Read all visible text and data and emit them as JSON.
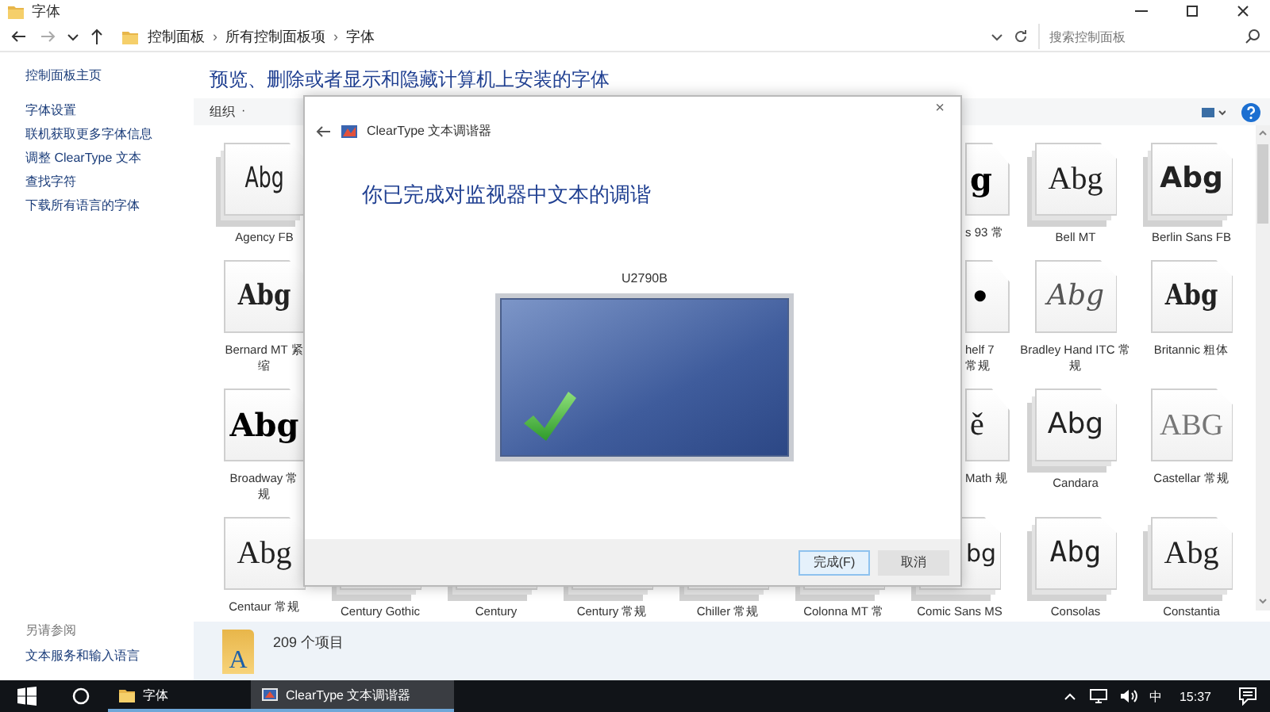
{
  "window": {
    "title": "字体"
  },
  "address_bar": {
    "breadcrumbs": [
      "控制面板",
      "所有控制面板项",
      "字体"
    ],
    "separator": "›"
  },
  "search": {
    "placeholder": "搜索控制面板"
  },
  "sidebar": {
    "home": "控制面板主页",
    "links": [
      "字体设置",
      "联机获取更多字体信息",
      "调整 ClearType 文本",
      "查找字符",
      "下载所有语言的字体"
    ],
    "see_also_title": "另请参阅",
    "see_also": [
      "文本服务和输入语言"
    ]
  },
  "heading": "预览、删除或者显示和隐藏计算机上安装的字体",
  "toolbar": {
    "organize": "组织",
    "organize_caret": "·"
  },
  "font_rows": [
    {
      "tiles": [
        {
          "kind": "full",
          "label": "Agency FB",
          "sample": {
            "text": "Abg",
            "kind": "condensed"
          },
          "stacked": true
        },
        {
          "kind": "cut",
          "label": "s 93 常",
          "sample": {
            "text": "g",
            "kind": "black"
          }
        },
        {
          "kind": "full",
          "label": "Bell MT",
          "sample": {
            "text": "Abg",
            "kind": "serif"
          },
          "stacked": true
        },
        {
          "kind": "full",
          "label": "Berlin Sans FB",
          "sample": {
            "text": "Abg",
            "kind": "bold-sans"
          },
          "stacked": true
        }
      ]
    },
    {
      "tiles": [
        {
          "kind": "full",
          "label": "Bernard MT 紧缩",
          "sample": {
            "text": "Abg",
            "kind": "heavy-serif"
          },
          "stacked": false
        },
        {
          "kind": "cut",
          "label": "helf 7 常规",
          "sample": {
            "text": "•",
            "kind": "black"
          }
        },
        {
          "kind": "full",
          "label": "Bradley Hand ITC 常规",
          "sample": {
            "text": "Abg",
            "kind": "script"
          },
          "stacked": false
        },
        {
          "kind": "full",
          "label": "Britannic 粗体",
          "sample": {
            "text": "Abg",
            "kind": "heavy-serif"
          },
          "stacked": false
        }
      ]
    },
    {
      "tiles": [
        {
          "kind": "full",
          "label": "Broadway 常规",
          "sample": {
            "text": "Abg",
            "kind": "black"
          },
          "stacked": false
        },
        {
          "kind": "cut",
          "label": "Math 规",
          "sample": {
            "text": "ě",
            "kind": "serif"
          }
        },
        {
          "kind": "full",
          "label": "Candara",
          "sample": {
            "text": "Abg",
            "kind": "sans"
          },
          "stacked": true
        },
        {
          "kind": "full",
          "label": "Castellar 常规",
          "sample": {
            "text": "ABG",
            "kind": "caps-serif"
          },
          "stacked": false
        }
      ]
    },
    {
      "tiles": [
        {
          "kind": "full",
          "label": "Centaur 常规",
          "sample": {
            "text": "Abg",
            "kind": "serif"
          },
          "stacked": false
        },
        {
          "kind": "full",
          "label": "Century Gothic",
          "stacked": true
        },
        {
          "kind": "full",
          "label": "Century",
          "stacked": true
        },
        {
          "kind": "full",
          "label": "Century 常规",
          "stacked": true
        },
        {
          "kind": "full",
          "label": "Chiller 常规",
          "stacked": true
        },
        {
          "kind": "full",
          "label": "Colonna MT 常",
          "stacked": true
        },
        {
          "kind": "cut-icon",
          "label": "Comic Sans MS",
          "sample": {
            "text": "bg",
            "kind": "sans"
          },
          "stacked": true
        },
        {
          "kind": "full",
          "label": "Consolas",
          "sample": {
            "text": "Abg",
            "kind": "mono"
          },
          "stacked": true
        },
        {
          "kind": "full",
          "label": "Constantia",
          "sample": {
            "text": "Abg",
            "kind": "serif"
          },
          "stacked": true
        }
      ]
    }
  ],
  "status_bar": {
    "icon_letter": "A",
    "count": "209 个项目"
  },
  "dialog": {
    "title": "ClearType 文本调谐器",
    "close": "×",
    "message": "你已完成对监视器中文本的调谐",
    "monitor_name": "U2790B",
    "buttons": [
      {
        "label": "完成(F)",
        "focused": true
      },
      {
        "label": "取消",
        "focused": false
      }
    ]
  },
  "taskbar": {
    "apps": [
      {
        "label": "字体",
        "selected": false
      },
      {
        "label": "ClearType 文本调谐器",
        "selected": true
      }
    ],
    "ime": "中",
    "time": "15:37"
  }
}
